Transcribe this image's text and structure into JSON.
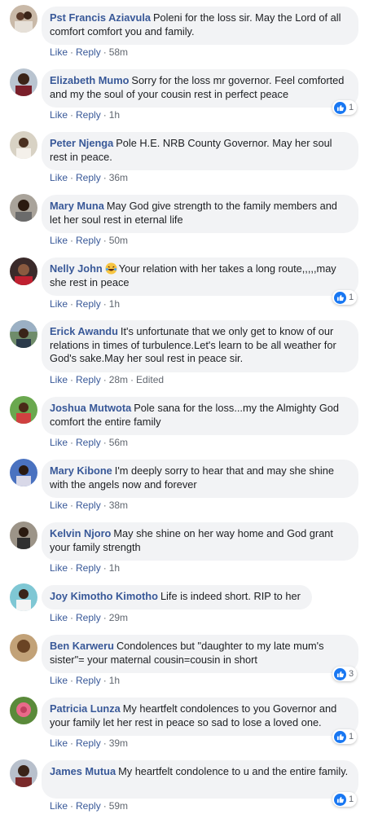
{
  "comments": [
    {
      "author": "Pst Francis Aziavula",
      "text": "Poleni for the loss sir. May the Lord of all comfort comfort you and family.",
      "like": "Like",
      "reply": "Reply",
      "time": "58m",
      "edited": "",
      "reactions": ""
    },
    {
      "author": "Elizabeth Mumo",
      "text": "Sorry for the loss mr governor. Feel comforted and my the soul of your cousin rest in perfect peace",
      "like": "Like",
      "reply": "Reply",
      "time": "1h",
      "edited": "",
      "reactions": "1"
    },
    {
      "author": "Peter Njenga",
      "text": "Pole H.E. NRB County Governor. May her soul rest in peace.",
      "like": "Like",
      "reply": "Reply",
      "time": "36m",
      "edited": "",
      "reactions": ""
    },
    {
      "author": "Mary Muna",
      "text": "May God give strength to the family members and let her soul rest in eternal life",
      "like": "Like",
      "reply": "Reply",
      "time": "50m",
      "edited": "",
      "reactions": ""
    },
    {
      "author": "Nelly John",
      "text": "Your relation with her takes a long route,,,,,may she rest in peace",
      "like": "Like",
      "reply": "Reply",
      "time": "1h",
      "edited": "",
      "reactions": "1"
    },
    {
      "author": "Erick Awandu",
      "text": "It's unfortunate that we only get to know of our relations in times of turbulence.Let's learn to be all weather for God's sake.May her soul rest in peace sir.",
      "like": "Like",
      "reply": "Reply",
      "time": "28m",
      "edited": "Edited",
      "reactions": ""
    },
    {
      "author": "Joshua Mutwota",
      "text": "Pole sana for the loss...my the Almighty God comfort the entire family",
      "like": "Like",
      "reply": "Reply",
      "time": "56m",
      "edited": "",
      "reactions": ""
    },
    {
      "author": "Mary Kibone",
      "text": "I'm deeply sorry to hear that and may she shine with the angels now and forever",
      "like": "Like",
      "reply": "Reply",
      "time": "38m",
      "edited": "",
      "reactions": ""
    },
    {
      "author": "Kelvin Njoro",
      "text": "May she shine on her way home and God grant your family strength",
      "like": "Like",
      "reply": "Reply",
      "time": "1h",
      "edited": "",
      "reactions": ""
    },
    {
      "author": "Joy Kimotho Kimotho",
      "text": "Life is indeed short. RIP to her",
      "like": "Like",
      "reply": "Reply",
      "time": "29m",
      "edited": "",
      "reactions": ""
    },
    {
      "author": "Ben Karweru",
      "text": "Condolences but \"daughter to my late mum's sister\"= your maternal cousin=cousin in short",
      "like": "Like",
      "reply": "Reply",
      "time": "1h",
      "edited": "",
      "reactions": "3"
    },
    {
      "author": "Patricia Lunza",
      "text": "My heartfelt condolences to you Governor and your family let her rest in peace so sad to lose a loved one.",
      "like": "Like",
      "reply": "Reply",
      "time": "39m",
      "edited": "",
      "reactions": "1"
    },
    {
      "author": "James Mutua",
      "text": "My heartfelt condolence to u and the entire family.",
      "like": "Like",
      "reply": "Reply",
      "time": "59m",
      "edited": "",
      "reactions": "1"
    }
  ],
  "colors": {
    "author": "#385898",
    "bubble": "#f2f3f5",
    "meta": "#616770",
    "like_blue": "#1877f2"
  },
  "icons": {
    "reaction": "like-icon",
    "emoji": "laughing-tears-emoji"
  }
}
